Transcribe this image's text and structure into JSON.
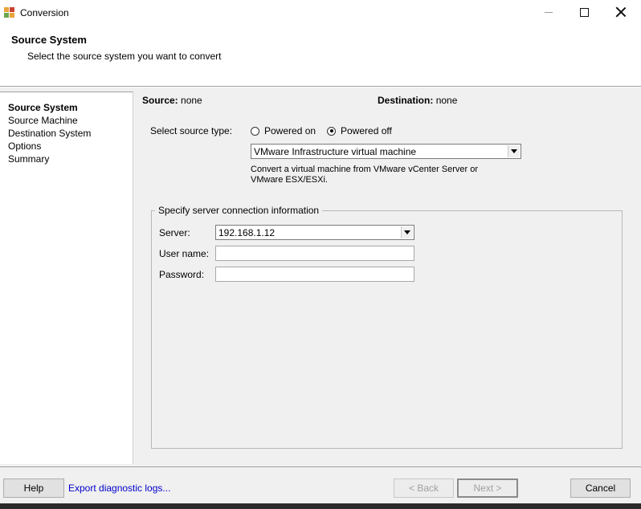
{
  "window": {
    "title": "Conversion"
  },
  "header": {
    "title": "Source System",
    "subtitle": "Select the source system you want to convert"
  },
  "sidebar": {
    "items": [
      {
        "label": "Source System",
        "active": true
      },
      {
        "label": "Source Machine",
        "active": false
      },
      {
        "label": "Destination System",
        "active": false
      },
      {
        "label": "Options",
        "active": false
      },
      {
        "label": "Summary",
        "active": false
      }
    ]
  },
  "summary": {
    "source_label": "Source:",
    "source_value": "none",
    "destination_label": "Destination:",
    "destination_value": "none"
  },
  "source_type": {
    "label": "Select source type:",
    "options": [
      {
        "label": "Powered on",
        "selected": false
      },
      {
        "label": "Powered off",
        "selected": true
      }
    ],
    "selected_machine_type": "VMware Infrastructure virtual machine",
    "description": "Convert a virtual machine from VMware vCenter Server or VMware ESX/ESXi."
  },
  "connection": {
    "group_title": "Specify server connection information",
    "server_label": "Server:",
    "server_value": "192.168.1.12",
    "username_label": "User name:",
    "username_value": "",
    "password_label": "Password:",
    "password_value": ""
  },
  "footer": {
    "help_label": "Help",
    "export_link": "Export diagnostic logs...",
    "back_label": "< Back",
    "next_label": "Next >",
    "cancel_label": "Cancel"
  }
}
